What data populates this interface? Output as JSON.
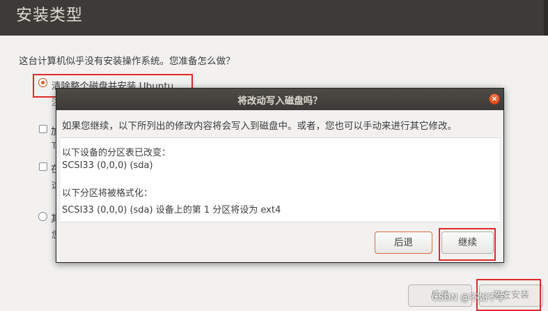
{
  "header": {
    "title": "安装类型"
  },
  "page": {
    "question": "这台计算机似乎没有安装操作系统。您准备怎么做？",
    "options": [
      {
        "label": "清除整个磁盘并安装 Ubuntu",
        "sub": "注",
        "selected": true,
        "kind": "radio"
      },
      {
        "label": "加",
        "sub": "T",
        "selected": false,
        "kind": "checkbox"
      },
      {
        "label": "在",
        "sub": "这",
        "selected": false,
        "kind": "checkbox"
      },
      {
        "label": "其",
        "sub": "您",
        "selected": false,
        "kind": "radio"
      }
    ],
    "buttons": {
      "back": "后退",
      "install": "现在安装"
    },
    "watermark": "CSDN @不如不学"
  },
  "dialog": {
    "title": "将改动写入磁盘吗？",
    "message": "如果您继续，以下所列出的修改内容将会写入到磁盘中。或者，您也可以手动来进行其它修改。",
    "partition_table_heading": "以下设备的分区表已改变：",
    "partition_table_device": "SCSI33 (0,0,0) (sda)",
    "format_heading": "以下分区将被格式化：",
    "format_detail": "SCSI33 (0,0,0) (sda) 设备上的第 1 分区将设为 ext4",
    "back_label": "后退",
    "continue_label": "继续",
    "close_glyph": "×"
  },
  "colors": {
    "accent": "#e05a1e",
    "annotation": "#e02a2a",
    "header": "#3c3b37"
  }
}
